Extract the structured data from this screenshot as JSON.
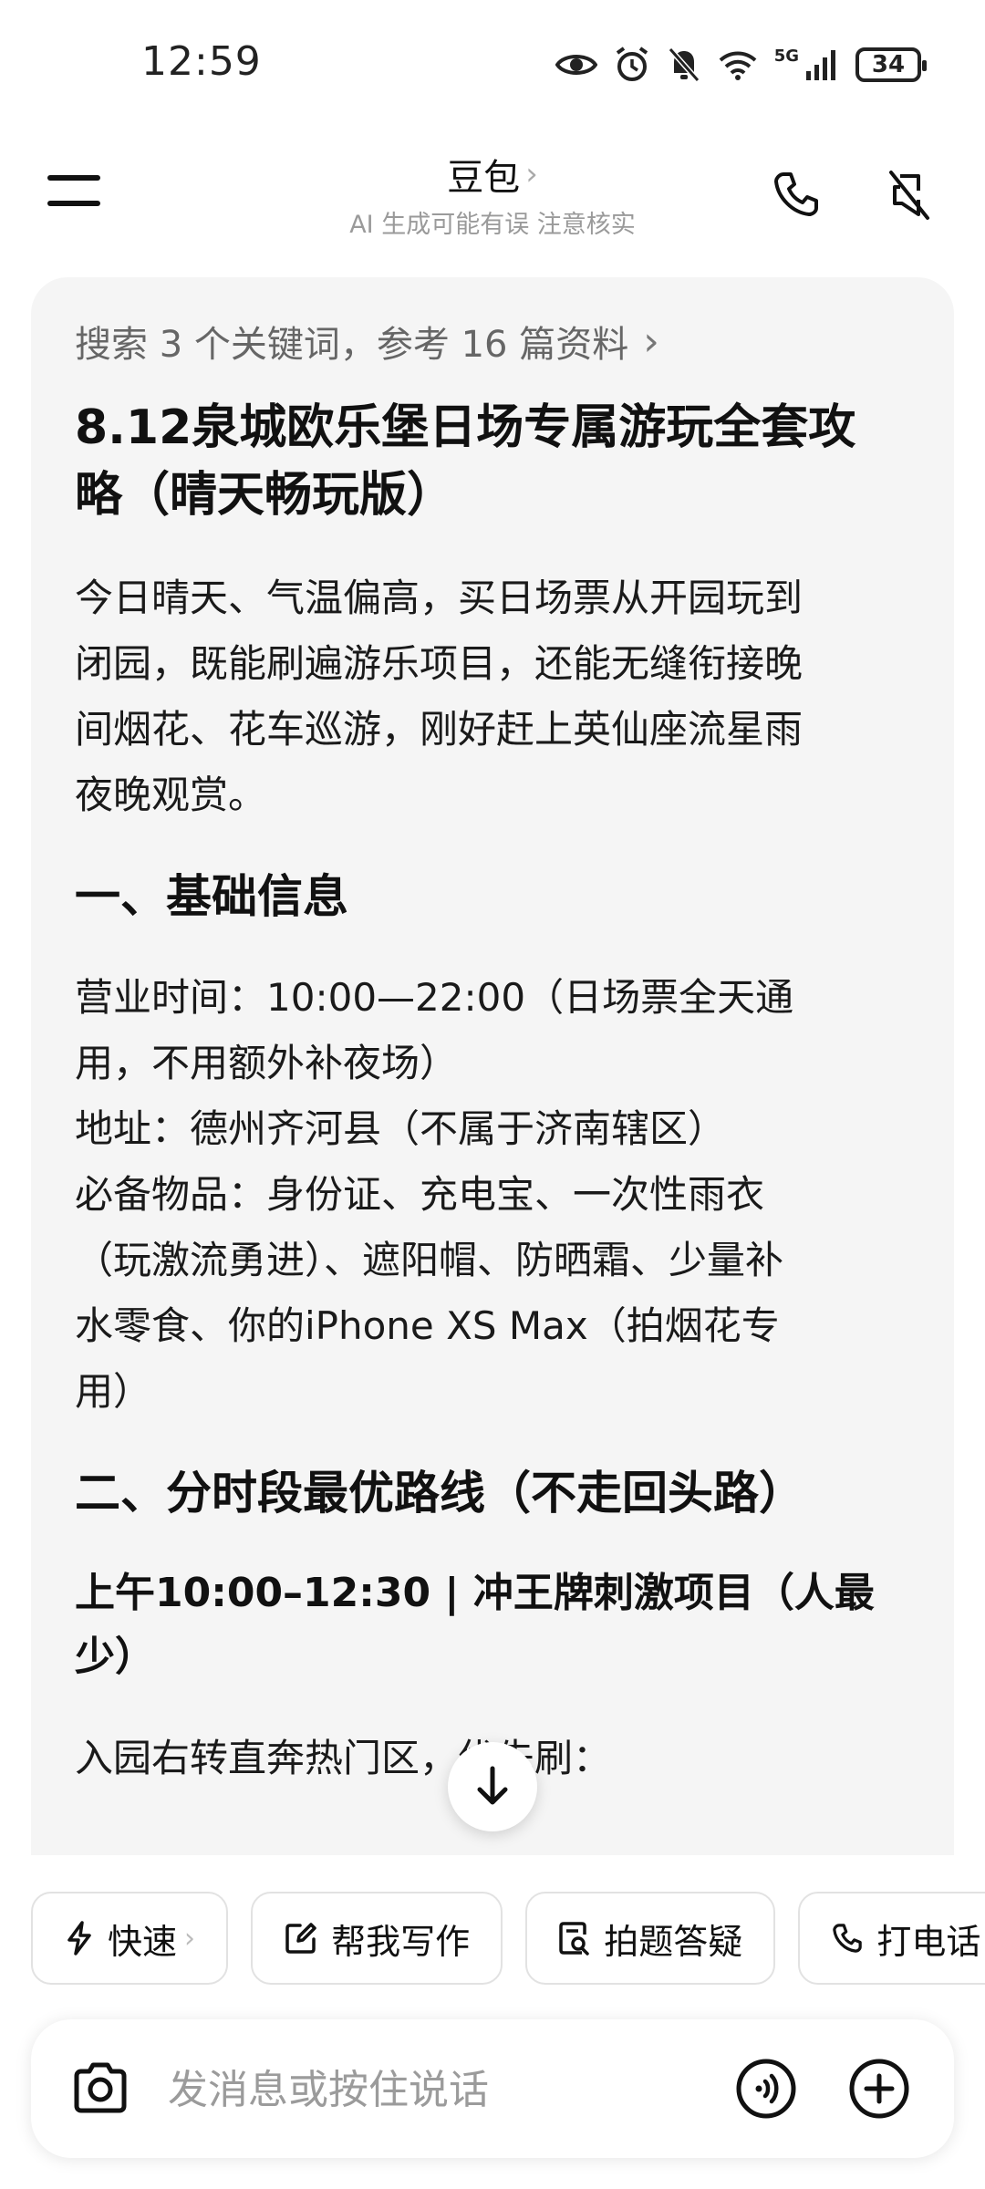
{
  "status_bar": {
    "time": "12:59",
    "network": "5G",
    "battery": "34"
  },
  "header": {
    "title": "豆包",
    "title_chevron": "›",
    "subtitle": "AI 生成可能有误 注意核实"
  },
  "message": {
    "search_summary": "搜索 3 个关键词，参考 16 篇资料",
    "search_chevron": "›",
    "title_lines": [
      "8.12泉城欧乐堡日场专属游玩全套攻",
      "略（晴天畅玩版）"
    ],
    "intro_lines": [
      "今日晴天、气温偏高，买日场票从开园玩到",
      "闭园，既能刷遍游乐项目，还能无缝衔接晚",
      "间烟花、花车巡游，刚好赶上英仙座流星雨",
      "夜晚观赏。"
    ],
    "section1_heading": "一、基础信息",
    "section1_lines": [
      "营业时间：10:00—22:00（日场票全天通",
      "用，不用额外补夜场）",
      "地址：德州齐河县（不属于济南辖区）",
      "必备物品：身份证、充电宝、一次性雨衣",
      "（玩激流勇进）、遮阳帽、防晒霜、少量补",
      "水零食、你的iPhone XS Max（拍烟花专",
      "用）"
    ],
    "section2_heading": "二、分时段最优路线（不走回头路）",
    "sub1_heading_lines": [
      "上午10:00–12:30 | 冲王牌刺激项目（人最",
      "少）"
    ],
    "sub1_text": "入园右转直奔热门区，优先刷："
  },
  "chips": [
    {
      "label": "快速",
      "icon": "lightning-icon",
      "chevron": "›"
    },
    {
      "label": "帮我写作",
      "icon": "edit-icon"
    },
    {
      "label": "拍题答疑",
      "icon": "scan-doc-icon"
    },
    {
      "label": "打电话",
      "icon": "phone-icon"
    }
  ],
  "input": {
    "placeholder": "发消息或按住说话"
  }
}
